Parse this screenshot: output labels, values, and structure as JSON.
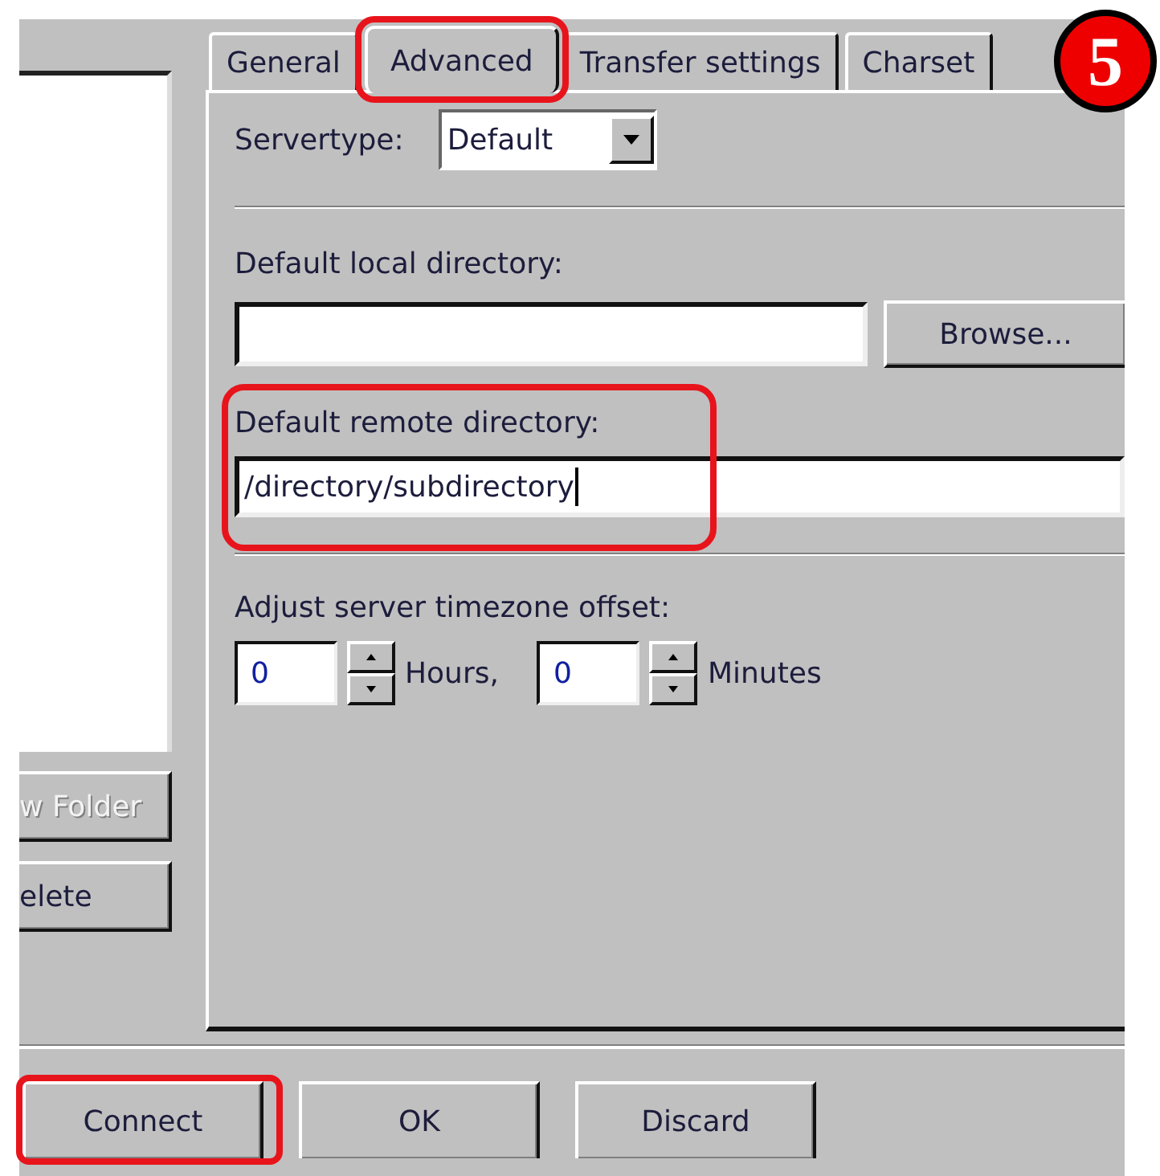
{
  "left_panel": {
    "buttons": [
      {
        "label": "w Folder",
        "disabled": true
      },
      {
        "label": "elete",
        "disabled": false
      }
    ]
  },
  "tabs": [
    {
      "label": "General",
      "selected": false,
      "highlighted": false
    },
    {
      "label": "Advanced",
      "selected": true,
      "highlighted": true
    },
    {
      "label": "Transfer settings",
      "selected": false,
      "highlighted": false
    },
    {
      "label": "Charset",
      "selected": false,
      "highlighted": false
    }
  ],
  "servertype": {
    "label": "Servertype:",
    "value": "Default"
  },
  "local_directory": {
    "label": "Default local directory:",
    "button": "Browse..."
  },
  "remote_directory": {
    "label": "Default remote directory:",
    "value": "/directory/subdirectory",
    "highlighted": true
  },
  "timezone": {
    "label": "Adjust server timezone offset:",
    "hours": "0",
    "hours_label": "Hours,",
    "minutes": "0",
    "minutes_label": "Minutes"
  },
  "buttons": [
    {
      "label": "Connect",
      "highlighted": true
    },
    {
      "label": "OK",
      "highlighted": false
    },
    {
      "label": "Discard",
      "highlighted": false
    }
  ],
  "step_badge": "5"
}
